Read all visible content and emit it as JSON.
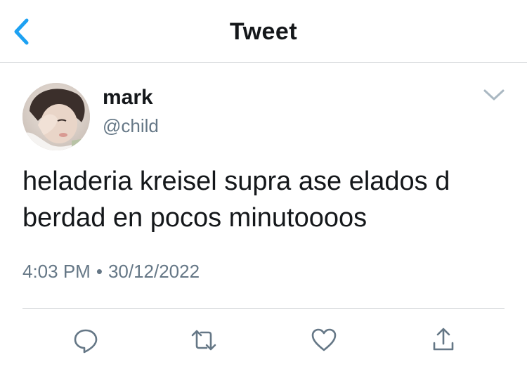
{
  "header": {
    "title": "Tweet",
    "back_icon": "chevron-left-icon",
    "accent_color": "#1da1f2"
  },
  "author": {
    "display_name": "mark",
    "handle": "@child",
    "avatar": "avatar-photo"
  },
  "tweet": {
    "text": "heladeria kreisel supra ase elados d berdad en pocos minutoooos",
    "time": "4:03 PM",
    "separator": "•",
    "date": "30/12/2022"
  },
  "actions": [
    {
      "icon": "reply-icon"
    },
    {
      "icon": "retweet-icon"
    },
    {
      "icon": "like-icon"
    },
    {
      "icon": "share-icon"
    }
  ],
  "colors": {
    "text": "#14171a",
    "secondary": "#657786",
    "divider": "#c9cdd1",
    "icon": "#657786"
  }
}
